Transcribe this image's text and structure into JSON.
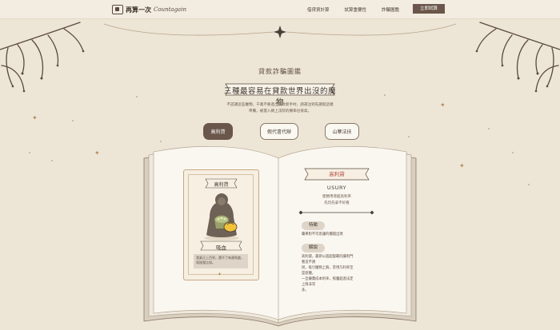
{
  "header": {
    "logo_text": "再算一次",
    "logo_sub": "Countagain",
    "nav": [
      "借貸資計算",
      "試算重要性",
      "詐騙圖鑑"
    ],
    "cta": "立即試算"
  },
  "section_title": "貸款詐騙圖鑑",
  "banner_text": "三種最容易在貸款世界出沒的魔物",
  "description": [
    "不認識這些魔物，千萬不要進出貸款新手村，請運注到先期就這樣",
    "準備，被蓋入網上法院的機率也很高。"
  ],
  "tabs": [
    "高利貸",
    "假代書代辦",
    "山寨法扶"
  ],
  "card": {
    "label": "高利貸",
    "name": "吸血",
    "quote": "我真正上百利，還不了來源到處，幫過我比如。"
  },
  "right_page": {
    "banner": "高利貸",
    "english": "USURY",
    "sub1": "使勝用導超高利率",
    "sub2": "先玩先拿不好看",
    "pill1": "特徵",
    "text1": "藥單對不可思議的價錢出現",
    "pill2": "解說",
    "text2": [
      "高利貸，最新以超超蠻範的讓利門看這不誘",
      "拐，吸引魔物上鉤，常用乃利率至是惡聽，",
      "一旦嫌棄成本利率，照量超過法定上限非常",
      "多。"
    ]
  },
  "colors": {
    "background": "#ede5d6",
    "accent": "#6a564a",
    "highlight": "#b04a3e"
  }
}
